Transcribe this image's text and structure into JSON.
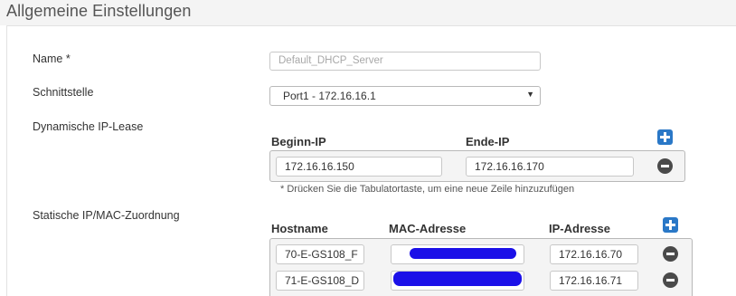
{
  "header": {
    "title": "Allgemeine Einstellungen"
  },
  "fields": {
    "name_label": "Name *",
    "name_placeholder": "Default_DHCP_Server",
    "interface_label": "Schnittstelle",
    "interface_value": "Port1 - 172.16.16.1",
    "dynamic_label": "Dynamische IP-Lease",
    "static_label": "Statische IP/MAC-Zuordnung"
  },
  "dynamic": {
    "start_header": "Beginn-IP",
    "end_header": "Ende-IP",
    "start_value": "172.16.16.150",
    "end_value": "172.16.16.170",
    "hint": "* Drücken Sie die Tabulatortaste, um eine neue Zeile hinzuzufügen"
  },
  "static": {
    "headers": {
      "hostname": "Hostname",
      "mac": "MAC-Adresse",
      "ip": "IP-Adresse"
    },
    "rows": [
      {
        "hostname": "70-E-GS108_F",
        "ip": "172.16.16.70"
      },
      {
        "hostname": "71-E-GS108_D",
        "ip": "172.16.16.71"
      }
    ]
  },
  "icons": {
    "add": "plus-icon",
    "remove": "minus-circle-icon",
    "dropdown": "chevron-down-icon"
  },
  "colors": {
    "accent": "#2a78c7",
    "redaction": "#1b10e8",
    "remove": "#4a4a4a"
  }
}
